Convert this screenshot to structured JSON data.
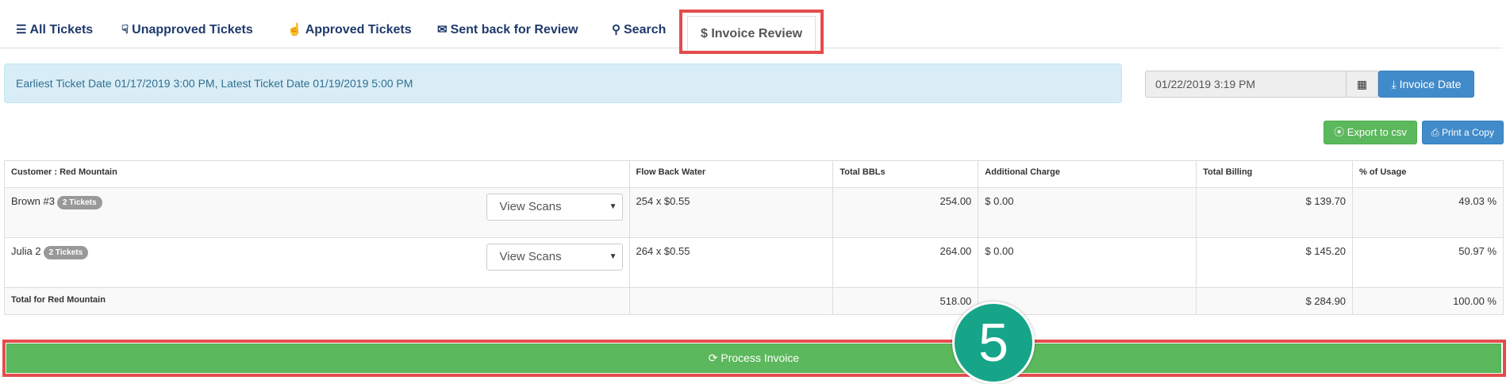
{
  "tabs": [
    {
      "icon": "☰",
      "label": "All Tickets"
    },
    {
      "icon": "👎",
      "label": "Unapproved Tickets"
    },
    {
      "icon": "👍",
      "label": "Approved Tickets"
    },
    {
      "icon": "✉",
      "label": "Sent back for Review"
    },
    {
      "icon": "🔍",
      "label": "Search"
    },
    {
      "icon": "$",
      "label": "Invoice Review"
    }
  ],
  "alert_text": "Earliest Ticket Date 01/17/2019 3:00 PM, Latest Ticket Date 01/19/2019 5:00 PM",
  "invoice_date_value": "01/22/2019 3:19 PM",
  "invoice_date_button": "Invoice Date",
  "export_button": "Export to csv",
  "print_button": "Print a Copy",
  "table": {
    "headers": [
      "Customer : Red Mountain",
      "Flow Back Water",
      "Total BBLs",
      "Additional Charge",
      "Total Billing",
      "% of Usage"
    ],
    "rows": [
      {
        "name": "Brown #3",
        "badge": "2 Tickets",
        "select": "View Scans",
        "flow": "254 x $0.55",
        "bbls": "254.00",
        "additional": "$ 0.00",
        "billing": "$ 139.70",
        "usage": "49.03 %"
      },
      {
        "name": "Julia 2",
        "badge": "2 Tickets",
        "select": "View Scans",
        "flow": "264 x $0.55",
        "bbls": "264.00",
        "additional": "$ 0.00",
        "billing": "$ 145.20",
        "usage": "50.97 %"
      }
    ],
    "total": {
      "label": "Total for Red Mountain",
      "bbls": "518.00",
      "billing": "$ 284.90",
      "usage": "100.00 %"
    }
  },
  "process_button": "Process Invoice",
  "step_number": "5",
  "colors": {
    "accent_red": "#e44c4c",
    "success": "#5cb85c",
    "primary": "#428bca",
    "step": "#17a589"
  }
}
